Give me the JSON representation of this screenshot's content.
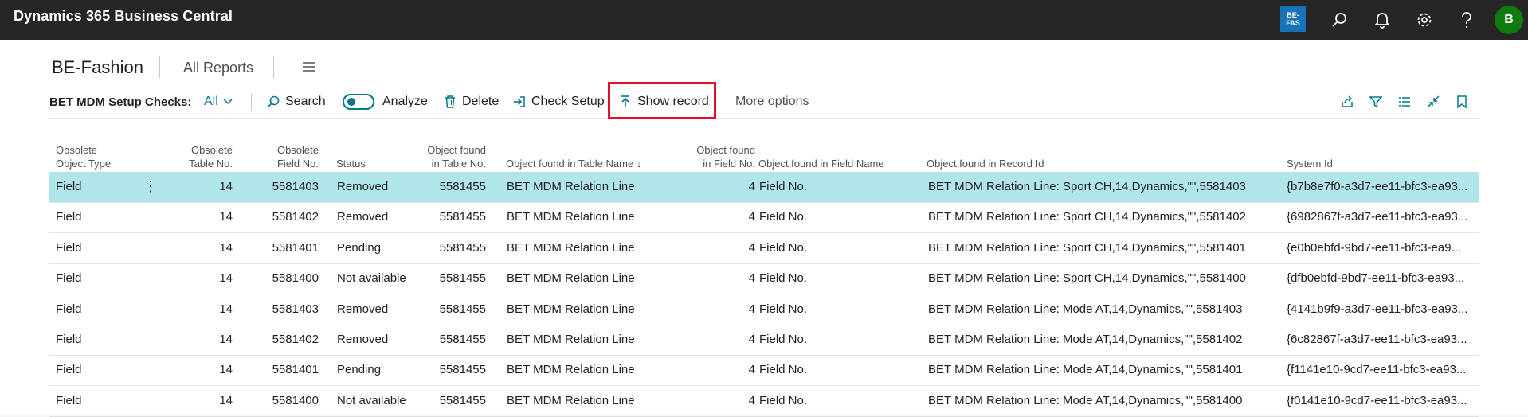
{
  "topbar": {
    "title": "Dynamics 365 Business Central",
    "badge": "BE-\nFAS",
    "avatar_initial": "B"
  },
  "titlebar": {
    "company": "BE-Fashion",
    "all_reports": "All Reports"
  },
  "actionbar": {
    "page_caption": "BET MDM Setup Checks:",
    "filter_label": "All",
    "search": "Search",
    "analyze": "Analyze",
    "delete": "Delete",
    "check_setup": "Check Setup",
    "show_record": "Show record",
    "more_options": "More options"
  },
  "columns": [
    {
      "line1": "Obsolete",
      "line2": "Object Type"
    },
    {
      "line1": "Obsolete",
      "line2": "Table No."
    },
    {
      "line1": "Obsolete",
      "line2": "Field No."
    },
    {
      "line1": "",
      "line2": "Status"
    },
    {
      "line1": "Object found",
      "line2": "in Table No."
    },
    {
      "line1": "",
      "line2": "Object found in Table Name ↓"
    },
    {
      "line1": "Object found",
      "line2": "in Field No."
    },
    {
      "line1": "",
      "line2": "Object found in Field Name"
    },
    {
      "line1": "",
      "line2": "Object found in Record Id"
    },
    {
      "line1": "",
      "line2": "System Id"
    }
  ],
  "rows": [
    [
      "Field",
      "14",
      "5581403",
      "Removed",
      "5581455",
      "BET MDM Relation Line",
      "4",
      "Field No.",
      "BET MDM Relation Line: Sport CH,14,Dynamics,\"\",5581403",
      "{b7b8e7f0-a3d7-ee11-bfc3-ea93..."
    ],
    [
      "Field",
      "14",
      "5581402",
      "Removed",
      "5581455",
      "BET MDM Relation Line",
      "4",
      "Field No.",
      "BET MDM Relation Line: Sport CH,14,Dynamics,\"\",5581402",
      "{6982867f-a3d7-ee11-bfc3-ea93..."
    ],
    [
      "Field",
      "14",
      "5581401",
      "Pending",
      "5581455",
      "BET MDM Relation Line",
      "4",
      "Field No.",
      "BET MDM Relation Line: Sport CH,14,Dynamics,\"\",5581401",
      "{e0b0ebfd-9bd7-ee11-bfc3-ea9..."
    ],
    [
      "Field",
      "14",
      "5581400",
      "Not available",
      "5581455",
      "BET MDM Relation Line",
      "4",
      "Field No.",
      "BET MDM Relation Line: Sport CH,14,Dynamics,\"\",5581400",
      "{dfb0ebfd-9bd7-ee11-bfc3-ea93..."
    ],
    [
      "Field",
      "14",
      "5581403",
      "Removed",
      "5581455",
      "BET MDM Relation Line",
      "4",
      "Field No.",
      "BET MDM Relation Line: Mode AT,14,Dynamics,\"\",5581403",
      "{4141b9f9-a3d7-ee11-bfc3-ea93..."
    ],
    [
      "Field",
      "14",
      "5581402",
      "Removed",
      "5581455",
      "BET MDM Relation Line",
      "4",
      "Field No.",
      "BET MDM Relation Line: Mode AT,14,Dynamics,\"\",5581402",
      "{6c82867f-a3d7-ee11-bfc3-ea93..."
    ],
    [
      "Field",
      "14",
      "5581401",
      "Pending",
      "5581455",
      "BET MDM Relation Line",
      "4",
      "Field No.",
      "BET MDM Relation Line: Mode AT,14,Dynamics,\"\",5581401",
      "{f1141e10-9cd7-ee11-bfc3-ea93..."
    ],
    [
      "Field",
      "14",
      "5581400",
      "Not available",
      "5581455",
      "BET MDM Relation Line",
      "4",
      "Field No.",
      "BET MDM Relation Line: Mode AT,14,Dynamics,\"\",5581400",
      "{f0141e10-9cd7-ee11-bfc3-ea93..."
    ]
  ],
  "colors": {
    "accent": "#00788a",
    "selected_row": "#b0e5ea",
    "highlight_box": "#e0102b",
    "topbar": "#262626"
  }
}
